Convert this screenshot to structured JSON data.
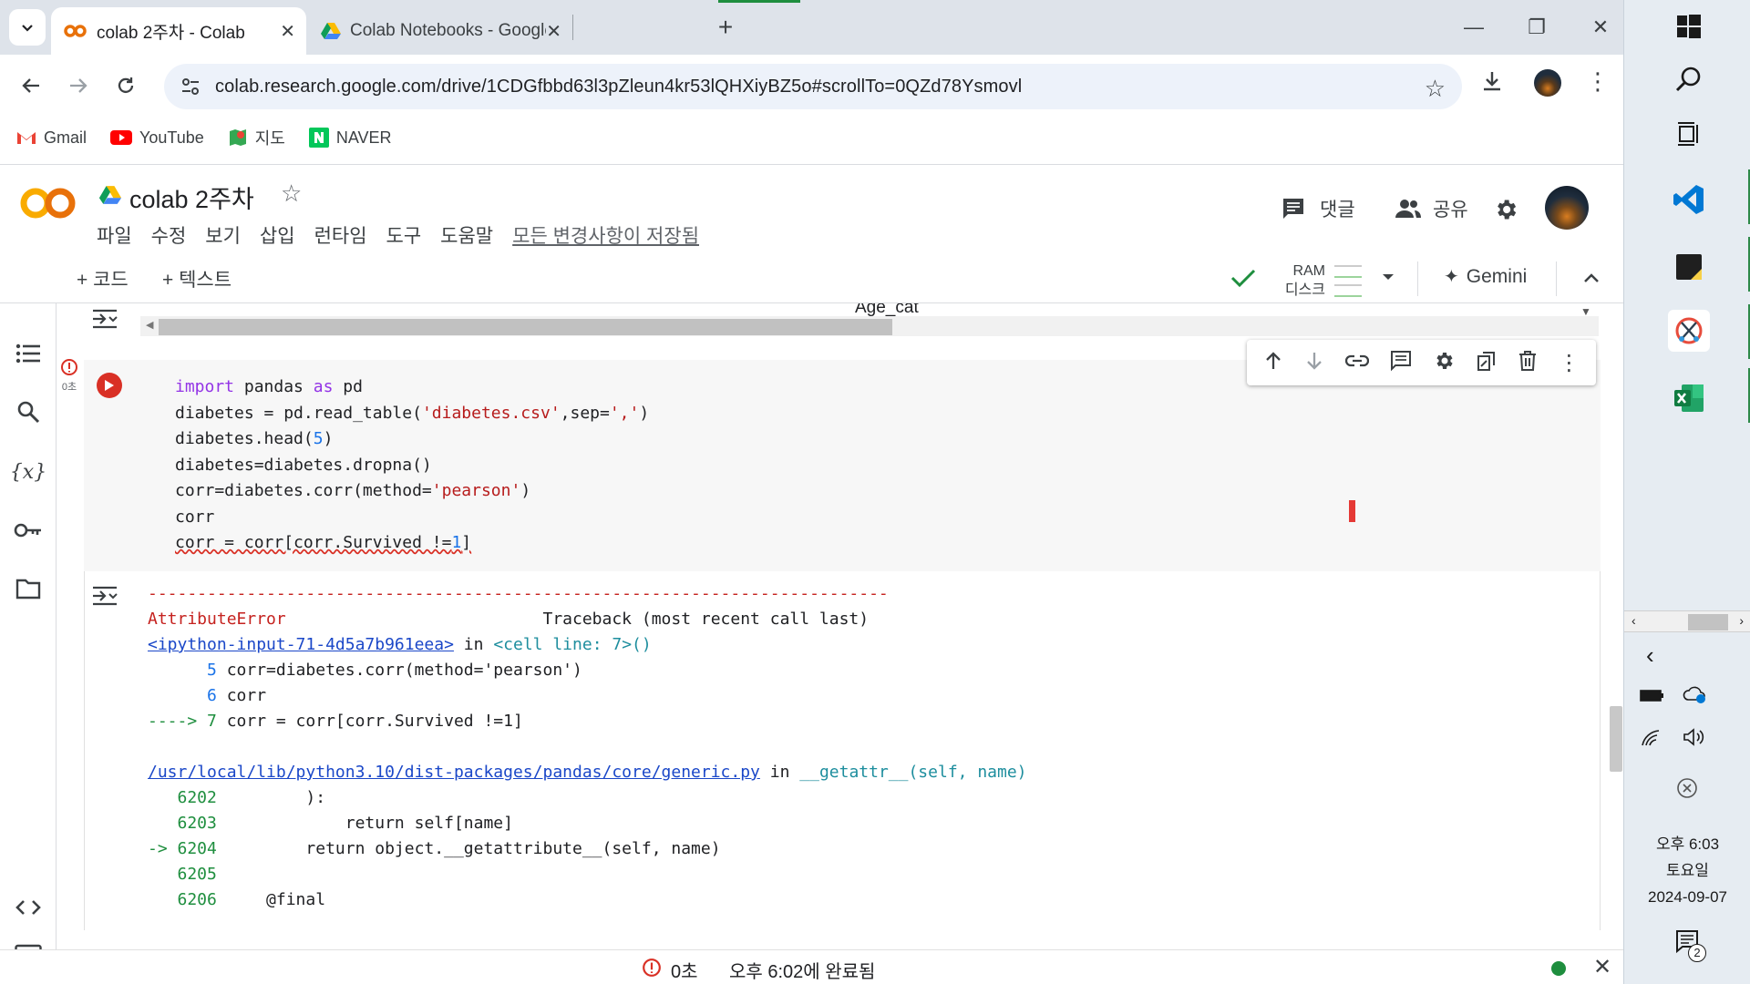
{
  "browser": {
    "tabs": [
      {
        "title": "colab 2주차 - Colab",
        "icon": "colab-icon",
        "active": true
      },
      {
        "title": "Colab Notebooks - Google Dr",
        "icon": "google-drive-icon",
        "active": false
      }
    ],
    "new_tab_label": "+",
    "url": "colab.research.google.com/drive/1CDGfbbd63l3pZleun4kr53lQHXiyBZ5o#scrollTo=0QZd78Ysmovl",
    "bookmarks": [
      {
        "label": "Gmail",
        "icon": "gmail-icon"
      },
      {
        "label": "YouTube",
        "icon": "youtube-icon"
      },
      {
        "label": "지도",
        "icon": "maps-icon"
      },
      {
        "label": "NAVER",
        "icon": "naver-icon"
      }
    ]
  },
  "colab": {
    "notebook_title": "colab 2주차",
    "menu": [
      "파일",
      "수정",
      "보기",
      "삽입",
      "런타임",
      "도구",
      "도움말"
    ],
    "saved_status": "모든 변경사항이 저장됨",
    "comment_label": "댓글",
    "share_label": "공유",
    "add_code_label": "코드",
    "add_text_label": "텍스트",
    "ram_label": "RAM",
    "disk_label": "디스크",
    "gemini_label": "Gemini",
    "prev_output_fragment": "Age_cat",
    "cell_exec_time": "0초",
    "code_lines": [
      "import pandas as pd",
      "diabetes = pd.read_table('diabetes.csv',sep=',')",
      "diabetes.head(5)",
      "diabetes=diabetes.dropna()",
      "corr=diabetes.corr(method='pearson')",
      "corr",
      "corr = corr[corr.Survived !=1]"
    ],
    "traceback": {
      "separator": "---------------------------------------------------------------------------",
      "error_name": "AttributeError",
      "header_right": "Traceback (most recent call last)",
      "input_link": "<ipython-input-71-4d5a7b961eea>",
      "in_text": "in",
      "cell_line": "<cell line: 7>()",
      "lines1": [
        {
          "prefix": "      5 ",
          "code": "corr=diabetes.corr(method='pearson')"
        },
        {
          "prefix": "      6 ",
          "code": "corr"
        },
        {
          "prefix": "----> 7 ",
          "code": "corr = corr[corr.Survived !=1]"
        }
      ],
      "file_link": "/usr/local/lib/python3.10/dist-packages/pandas/core/generic.py",
      "func": "__getattr__(self, name)",
      "lines2": [
        {
          "prefix": "   6202 ",
          "code": "        ):"
        },
        {
          "prefix": "   6203 ",
          "code": "            return self[name]"
        },
        {
          "prefix": "-> 6204 ",
          "code": "        return object.__getattribute__(self, name)"
        },
        {
          "prefix": "   6205 ",
          "code": ""
        },
        {
          "prefix": "   6206 ",
          "code": "    @final"
        }
      ]
    },
    "status": {
      "time": "0초",
      "completed": "오후 6:02에 완료됨"
    }
  },
  "taskbar": {
    "time": "오후 6:03",
    "weekday": "토요일",
    "date": "2024-09-07",
    "notifications": "2"
  }
}
